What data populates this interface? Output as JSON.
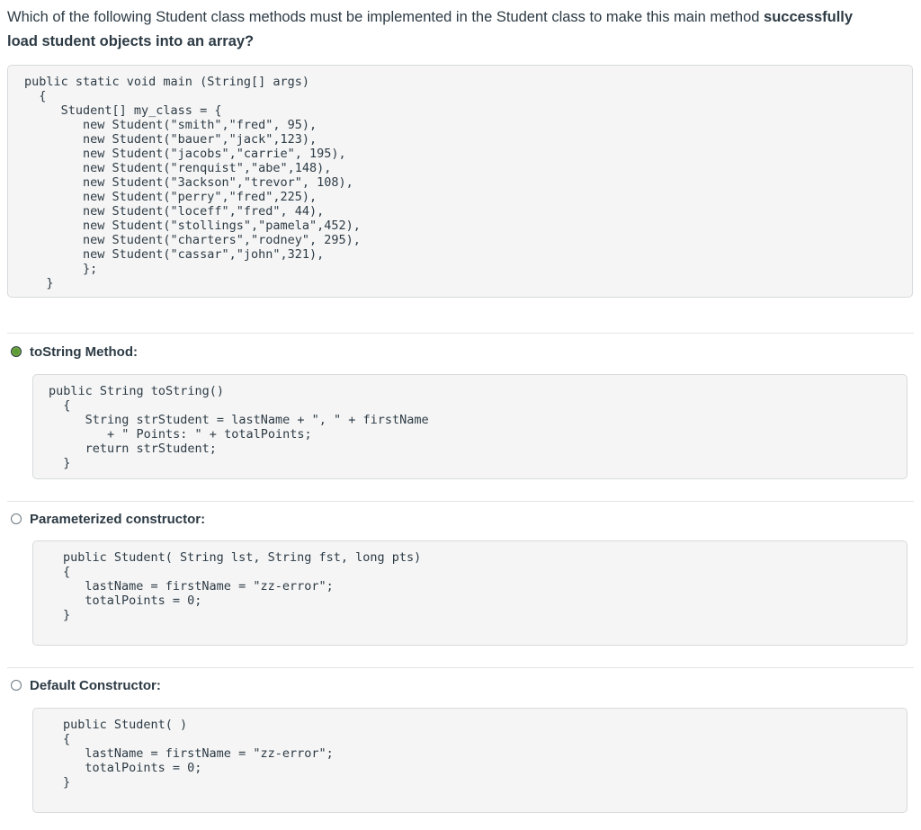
{
  "question": {
    "text_part1": "Which of the following Student class methods must be implemented in the Student class to make this main method ",
    "text_bold1": "successfully",
    "text_bold2": "load student objects into an array?"
  },
  "main_code": "public static void main (String[] args)\n  {\n     Student[] my_class = {\n        new Student(\"smith\",\"fred\", 95),\n        new Student(\"bauer\",\"jack\",123),\n        new Student(\"jacobs\",\"carrie\", 195),\n        new Student(\"renquist\",\"abe\",148),\n        new Student(\"3ackson\",\"trevor\", 108),\n        new Student(\"perry\",\"fred\",225),\n        new Student(\"loceff\",\"fred\", 44),\n        new Student(\"stollings\",\"pamela\",452),\n        new Student(\"charters\",\"rodney\", 295),\n        new Student(\"cassar\",\"john\",321),\n        };\n   }",
  "options": [
    {
      "label": "toString Method:",
      "selected": true,
      "code": "public String toString()\n  {\n     String strStudent = lastName + \", \" + firstName\n        + \" Points: \" + totalPoints;\n     return strStudent;\n  }"
    },
    {
      "label": "Parameterized constructor:",
      "selected": false,
      "code": "public Student( String lst, String fst, long pts)\n{\n   lastName = firstName = \"zz-error\";\n   totalPoints = 0;\n}"
    },
    {
      "label": "Default Constructor:",
      "selected": false,
      "code": "public Student( )\n{\n   lastName = firstName = \"zz-error\";\n   totalPoints = 0;\n}"
    }
  ],
  "colors": {
    "selected_radio": "#6ea640",
    "code_background": "#f5f5f5",
    "text": "#2d3b45"
  }
}
